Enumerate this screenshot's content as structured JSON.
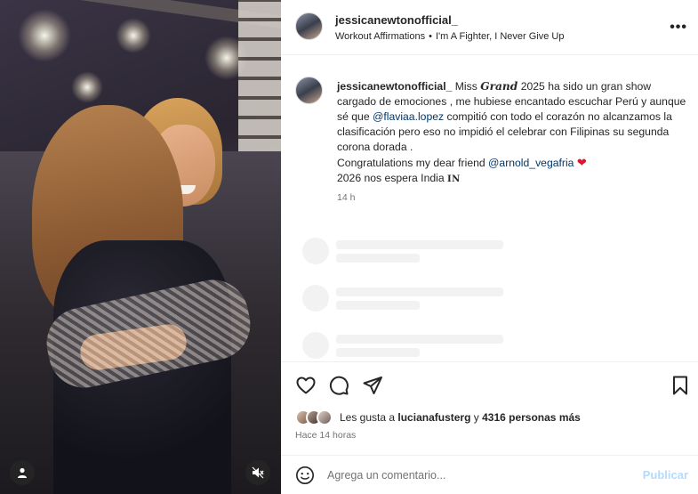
{
  "header": {
    "username": "jessicanewtonofficial_",
    "audio_title": "Workout Affirmations",
    "audio_separator": "•",
    "audio_artist": "I'm A Fighter, I Never Give Up",
    "more_label": "•••"
  },
  "caption": {
    "username": "jessicanewtonofficial_",
    "t1": " Miss ",
    "grand": "𝑮𝒓𝒂𝒏𝒅",
    "t2": " 2025 ha sido un gran show cargado de emociones , me hubiese encantado escuchar Perú y aunque sé que ",
    "mention1": "@flaviaa.lopez",
    "t3": " compitió con todo el corazón no alcanzamos la clasificación pero eso no impidió el celebrar con Filipinas su segunda corona dorada .",
    "t4": "Congratulations my dear friend ",
    "mention2": "@arnold_vegafria",
    "heart": "❤",
    "t5": "2026 nos espera India ",
    "india": "IN",
    "time": "14 h"
  },
  "likes": {
    "prefix": "Les gusta a ",
    "user": "lucianafusterg",
    "middle": " y ",
    "count": "4316 personas más"
  },
  "time_ago": "Hace 14 horas",
  "comment": {
    "placeholder": "Agrega un comentario...",
    "publish": "Publicar"
  },
  "icons": {
    "like": "heart-icon",
    "comment": "comment-icon",
    "share": "send-icon",
    "save": "bookmark-icon",
    "emoji": "emoji-icon",
    "user_tag": "user-icon",
    "mute": "speaker-muted-icon"
  },
  "colors": {
    "mention": "#00376b",
    "heart": "#e0142f",
    "publish_disabled": "#b3dbff",
    "secondary_text": "#737373"
  }
}
